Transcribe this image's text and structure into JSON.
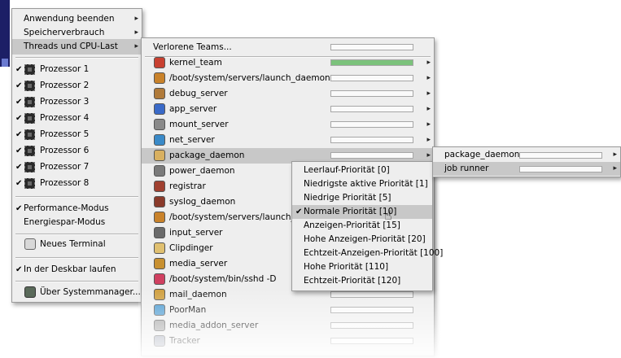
{
  "main_menu": {
    "items_top": [
      {
        "label": "Anwendung beenden"
      },
      {
        "label": "Speicherverbrauch"
      },
      {
        "label": "Threads und CPU-Last"
      }
    ],
    "processors": [
      {
        "label": "Prozessor 1"
      },
      {
        "label": "Prozessor 2"
      },
      {
        "label": "Prozessor 3"
      },
      {
        "label": "Prozessor 4"
      },
      {
        "label": "Prozessor 5"
      },
      {
        "label": "Prozessor 6"
      },
      {
        "label": "Prozessor 7"
      },
      {
        "label": "Prozessor 8"
      }
    ],
    "modes": [
      {
        "label": "Performance-Modus",
        "checked": true
      },
      {
        "label": "Energiespar-Modus",
        "checked": false
      }
    ],
    "terminal": "Neues Terminal",
    "deskbar": "In der Deskbar laufen",
    "about": "Über Systemmanager..."
  },
  "teams_menu": {
    "lost": "Verlorene Teams...",
    "teams": [
      {
        "label": "kernel_team",
        "icon": "kernel-icon",
        "load": 1.0
      },
      {
        "label": "/boot/system/servers/launch_daemon",
        "icon": "daemon-icon",
        "load": 0
      },
      {
        "label": "debug_server",
        "icon": "debug-icon",
        "load": 0
      },
      {
        "label": "app_server",
        "icon": "app-server-icon",
        "load": 0
      },
      {
        "label": "mount_server",
        "icon": "mount-icon",
        "load": 0
      },
      {
        "label": "net_server",
        "icon": "network-icon",
        "load": 0
      },
      {
        "label": "package_daemon",
        "icon": "package-icon",
        "load": 0
      },
      {
        "label": "power_daemon",
        "icon": "power-icon",
        "load": 0
      },
      {
        "label": "registrar",
        "icon": "registrar-icon",
        "load": 0
      },
      {
        "label": "syslog_daemon",
        "icon": "syslog-icon",
        "load": 0
      },
      {
        "label": "/boot/system/servers/launch_daemon",
        "icon": "daemon-icon",
        "load": 0
      },
      {
        "label": "input_server",
        "icon": "input-icon",
        "load": 0
      },
      {
        "label": "Clipdinger",
        "icon": "clipboard-icon",
        "load": 0
      },
      {
        "label": "media_server",
        "icon": "media-icon",
        "load": 0
      },
      {
        "label": "/boot/system/bin/sshd -D",
        "icon": "sshd-icon",
        "load": 0
      },
      {
        "label": "mail_daemon",
        "icon": "mail-icon",
        "load": 0
      },
      {
        "label": "PoorMan",
        "icon": "web-server-icon",
        "load": 0
      },
      {
        "label": "media_addon_server",
        "icon": "media-addon-icon",
        "load": 0
      },
      {
        "label": "Tracker",
        "icon": "tracker-icon",
        "load": 0
      }
    ]
  },
  "threads_menu": {
    "threads": [
      {
        "label": "package_daemon",
        "load": 0
      },
      {
        "label": "job runner",
        "load": 0
      }
    ]
  },
  "priority_menu": {
    "items": [
      {
        "label": "Leerlauf-Priorität [0]"
      },
      {
        "label": "Niedrigste aktive Priorität [1]"
      },
      {
        "label": "Niedrige Priorität [5]"
      },
      {
        "label": "Normale Priorität [10]",
        "checked": true
      },
      {
        "label": "Anzeigen-Priorität [15]"
      },
      {
        "label": "Hohe Anzeigen-Priorität [20]"
      },
      {
        "label": "Echtzeit-Anzeigen-Priorität [100]"
      },
      {
        "label": "Hohe Priorität [110]"
      },
      {
        "label": "Echtzeit-Priorität [120]"
      }
    ]
  },
  "colors": {
    "load_fill": "#7bc27b",
    "highlight": "#c8c8c8",
    "deskbar": "#1c1f66"
  }
}
